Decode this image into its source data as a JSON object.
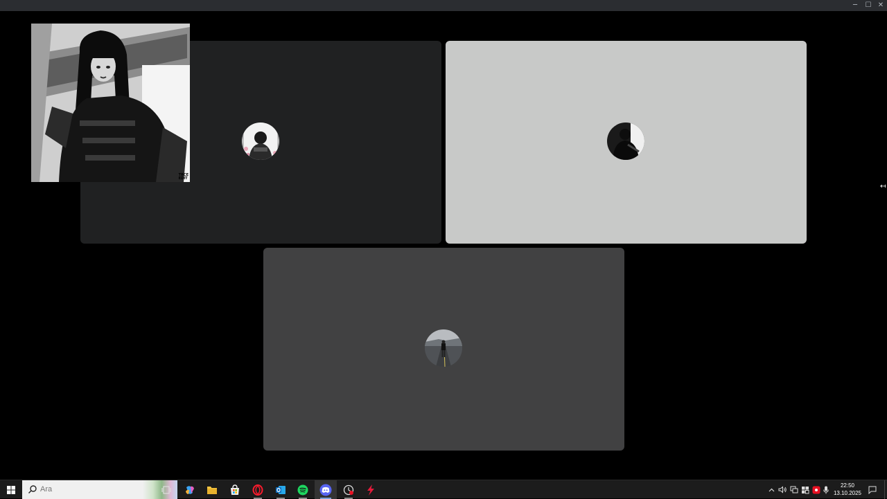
{
  "window": {
    "controls": {
      "minimize": "─",
      "maximize": "☐",
      "close": "✕"
    }
  },
  "call": {
    "tiles": [
      {
        "id": "participant-1",
        "background": "#202122",
        "avatar_style": "portrait-with-pink-flowers"
      },
      {
        "id": "participant-2",
        "background": "#c8c9c8",
        "avatar_style": "dark-portrait"
      },
      {
        "id": "participant-3",
        "background": "#414142",
        "avatar_style": "person-on-road"
      }
    ],
    "self_preview": {
      "style": "monochrome-illustration",
      "stamp": "TRCE\nEDIT"
    },
    "collapse_icon": "↤"
  },
  "taskbar": {
    "search": {
      "placeholder": "Ara",
      "value": ""
    },
    "apps": [
      {
        "name": "task-view",
        "icon": "task-view-icon"
      },
      {
        "name": "copilot",
        "icon": "copilot-icon"
      },
      {
        "name": "file-explorer",
        "icon": "folder-icon"
      },
      {
        "name": "microsoft-store",
        "icon": "store-icon"
      },
      {
        "name": "opera",
        "icon": "opera-icon"
      },
      {
        "name": "outlook",
        "icon": "outlook-icon"
      },
      {
        "name": "spotify",
        "icon": "spotify-icon"
      },
      {
        "name": "discord",
        "icon": "discord-icon"
      },
      {
        "name": "clock-app",
        "icon": "clock-app-icon"
      },
      {
        "name": "red-app",
        "icon": "lightning-icon"
      }
    ],
    "tray": {
      "chevron": "^",
      "clock_time": "22:50",
      "clock_date": "13.10.2025"
    }
  }
}
